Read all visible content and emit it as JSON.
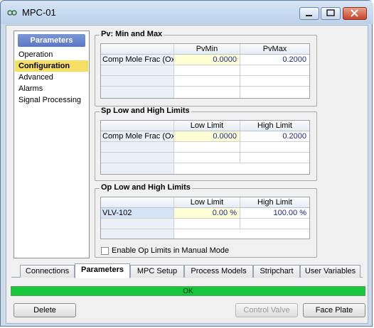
{
  "window": {
    "title": "MPC-01"
  },
  "sidebar": {
    "header": "Parameters",
    "items": [
      {
        "label": "Operation"
      },
      {
        "label": "Configuration"
      },
      {
        "label": "Advanced"
      },
      {
        "label": "Alarms"
      },
      {
        "label": "Signal Processing"
      }
    ],
    "active_item": "Configuration"
  },
  "pv_group": {
    "title": "Pv: Min and  Max",
    "columns": [
      "PvMin",
      "PvMax"
    ],
    "rows": [
      {
        "label": "Comp Mole Frac (Ox",
        "values": [
          "0.0000",
          "0.2000"
        ]
      }
    ]
  },
  "sp_group": {
    "title": "Sp Low and High Limits",
    "columns": [
      "Low Limit",
      "High Limit"
    ],
    "rows": [
      {
        "label": "Comp Mole Frac (Ox",
        "values": [
          "0.0000",
          "0.2000"
        ]
      }
    ]
  },
  "op_group": {
    "title": "Op Low and High Limits",
    "columns": [
      "Low Limit",
      "High Limit"
    ],
    "rows": [
      {
        "label": "VLV-102",
        "values": [
          "0.00 %",
          "100.00 %"
        ]
      }
    ],
    "manual_mode_checkbox": {
      "label": "Enable Op Limits in Manual Mode",
      "checked": false
    }
  },
  "tabs": [
    {
      "label": "Connections"
    },
    {
      "label": "Parameters"
    },
    {
      "label": "MPC Setup"
    },
    {
      "label": "Process Models"
    },
    {
      "label": "Stripchart"
    },
    {
      "label": "User Variables"
    }
  ],
  "active_tab": "Parameters",
  "status": {
    "text": "OK",
    "color": "#19c53b"
  },
  "buttons": {
    "delete": "Delete",
    "control_valve": "Control Valve",
    "face_plate": "Face Plate"
  }
}
